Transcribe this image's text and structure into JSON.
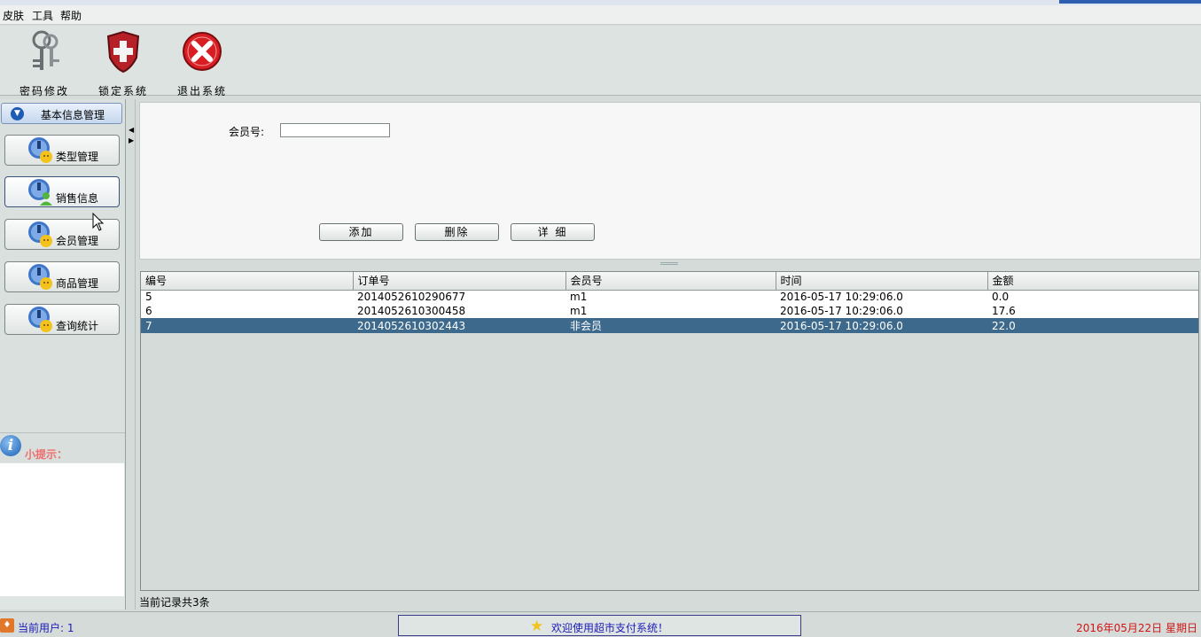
{
  "menu": {
    "items": [
      "皮肤",
      "工具",
      "帮助"
    ]
  },
  "toolbar": {
    "buttons": [
      {
        "label": "密码修改",
        "icon": "keys-icon"
      },
      {
        "label": "锁定系统",
        "icon": "shield-lock-icon"
      },
      {
        "label": "退出系统",
        "icon": "exit-x-icon"
      }
    ]
  },
  "sidebar": {
    "header": "基本信息管理",
    "items": [
      {
        "label": "类型管理",
        "icon": "user-info-icon"
      },
      {
        "label": "销售信息",
        "icon": "user-info-icon",
        "active": true
      },
      {
        "label": "会员管理",
        "icon": "user-info-icon"
      },
      {
        "label": "商品管理",
        "icon": "user-info-icon"
      },
      {
        "label": "查询统计",
        "icon": "user-info-icon"
      }
    ]
  },
  "tip": {
    "title": "小提示：",
    "body": ""
  },
  "form": {
    "member_label": "会员号:",
    "member_value": "",
    "buttons": {
      "add": "添加",
      "delete": "删除",
      "detail": "详 细"
    }
  },
  "table": {
    "columns": [
      "编号",
      "订单号",
      "会员号",
      "时间",
      "金额"
    ],
    "rows": [
      [
        "5",
        "2014052610290677",
        "m1",
        "2016-05-17 10:29:06.0",
        "0.0"
      ],
      [
        "6",
        "2014052610300458",
        "m1",
        "2016-05-17 10:29:06.0",
        "17.6"
      ],
      [
        "7",
        "2014052610302443",
        "非会员",
        "2016-05-17 10:29:06.0",
        "22.0"
      ]
    ],
    "selected_row": 2
  },
  "record_count": "当前记录共3条",
  "status": {
    "user": "当前用户:  1",
    "welcome": "欢迎使用超市支付系统！",
    "date": "2016年05月22日 星期日"
  },
  "colors": {
    "selected_row": "#3d6a8c",
    "status_blue": "#1b1bb8",
    "status_red": "#d21414",
    "tip_title": "#ee6e6e"
  }
}
